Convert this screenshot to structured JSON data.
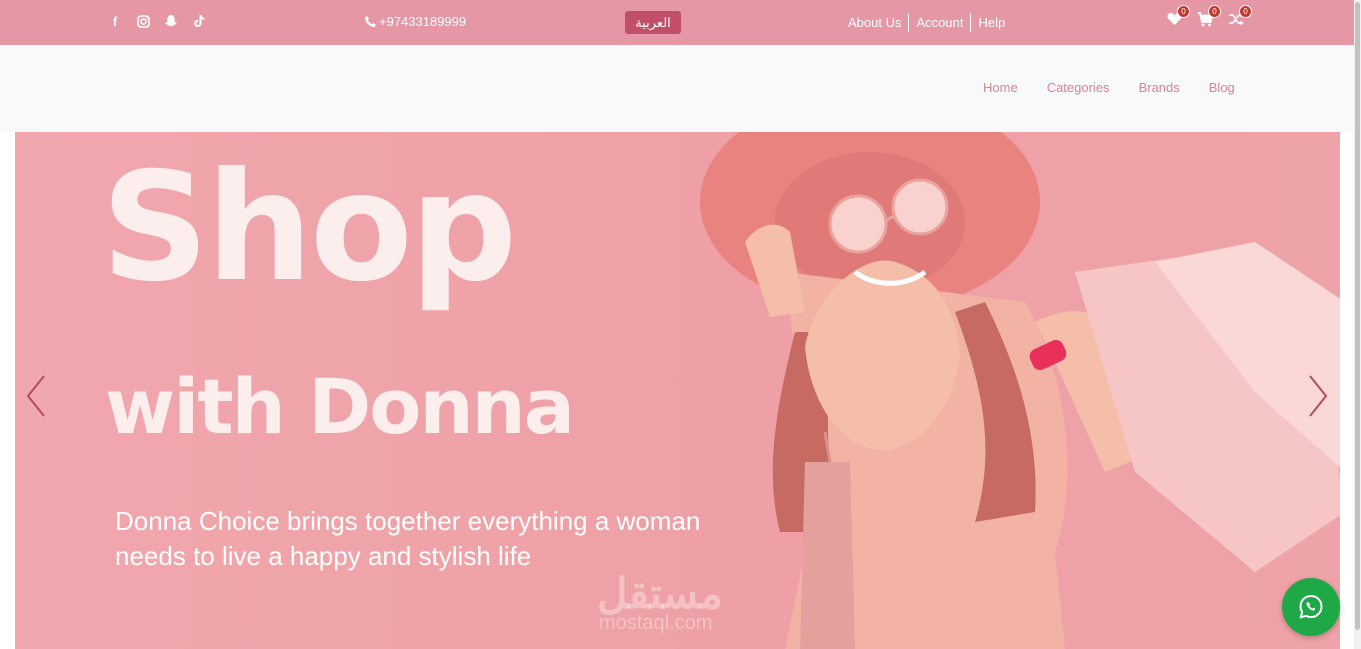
{
  "topbar": {
    "social_icons": [
      "facebook-icon",
      "instagram-icon",
      "snapchat-icon",
      "tiktok-icon"
    ],
    "phone": "+97433189999",
    "language_button": "العربية",
    "links": [
      "About Us",
      "Account",
      "Help"
    ],
    "wishlist_count": "0",
    "cart_count": "0",
    "compare_count": "0"
  },
  "nav": {
    "items": [
      "Home",
      "Categories",
      "Brands",
      "Blog"
    ]
  },
  "hero": {
    "title_line1": "Shop",
    "title_line2": "with Donna",
    "subtitle": "Donna Choice brings together everything a woman needs to live a happy and stylish life",
    "watermark": "مستقل",
    "watermark_sub": "mostaql.com"
  },
  "colors": {
    "topbar_bg": "#e597a6",
    "lang_button_bg": "#c24f68",
    "nav_link": "#d98494",
    "hero_bg": "#eea0a6",
    "whatsapp": "#1fa846"
  }
}
